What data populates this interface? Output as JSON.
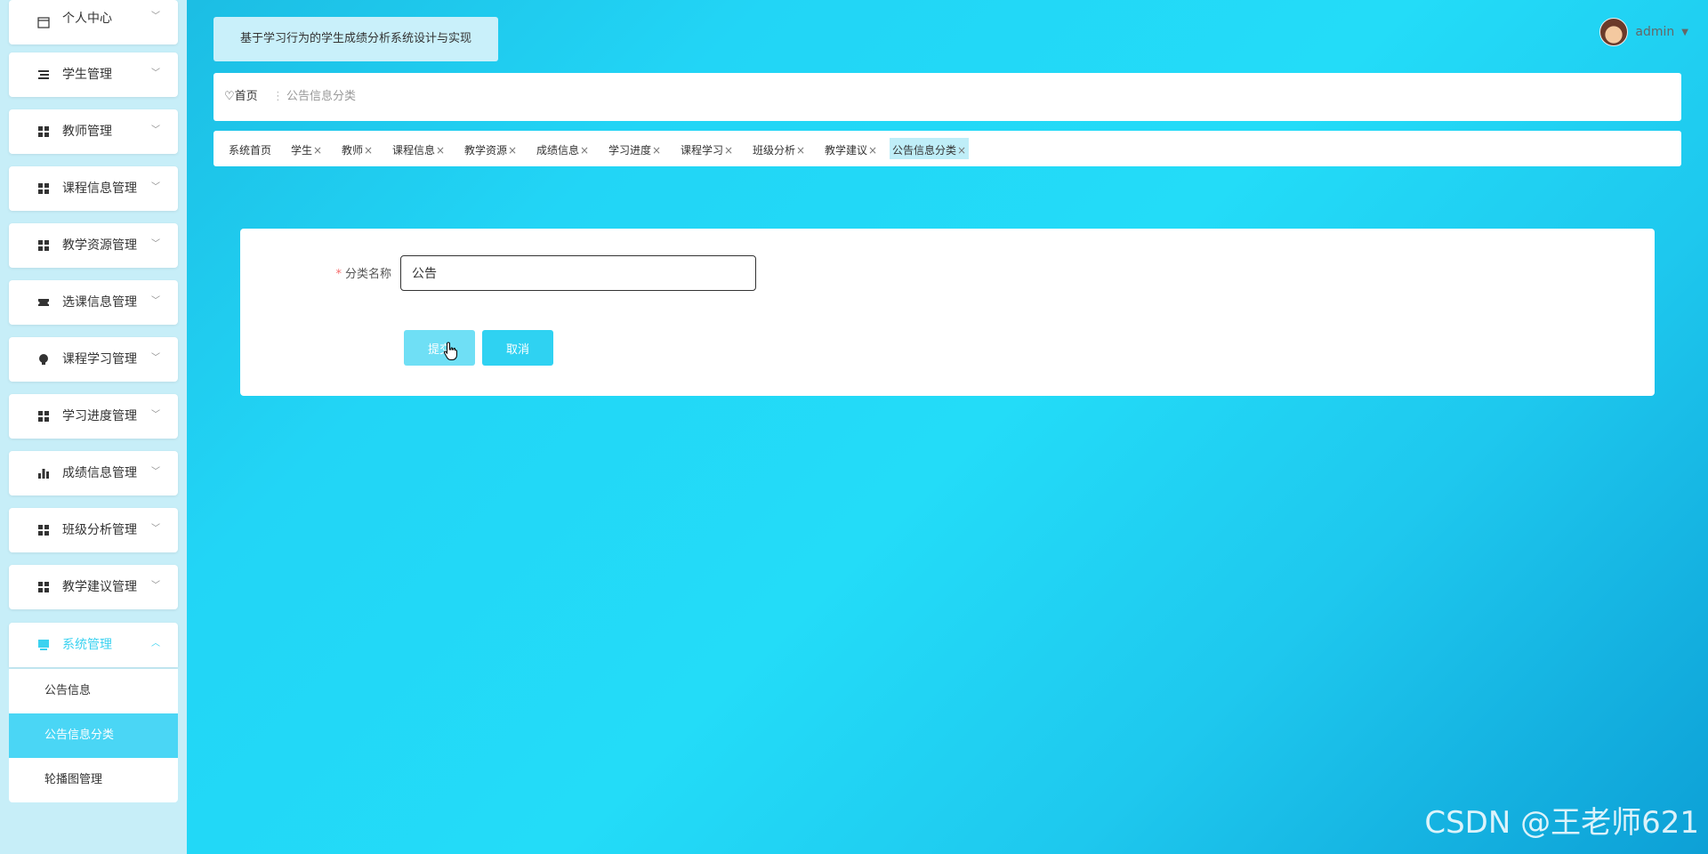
{
  "sidebar": {
    "items": [
      {
        "label": "个人中心",
        "icon": "calendar-icon"
      },
      {
        "label": "学生管理",
        "icon": "list-icon"
      },
      {
        "label": "教师管理",
        "icon": "grid-icon"
      },
      {
        "label": "课程信息管理",
        "icon": "grid-icon"
      },
      {
        "label": "教学资源管理",
        "icon": "grid-icon"
      },
      {
        "label": "选课信息管理",
        "icon": "ticket-icon"
      },
      {
        "label": "课程学习管理",
        "icon": "bulb-icon"
      },
      {
        "label": "学习进度管理",
        "icon": "grid-icon"
      },
      {
        "label": "成绩信息管理",
        "icon": "bar-chart-icon"
      },
      {
        "label": "班级分析管理",
        "icon": "grid-icon"
      },
      {
        "label": "教学建议管理",
        "icon": "grid-icon"
      },
      {
        "label": "系统管理",
        "icon": "monitor-icon",
        "expanded": true
      }
    ],
    "submenu": [
      {
        "label": "公告信息"
      },
      {
        "label": "公告信息分类",
        "selected": true
      },
      {
        "label": "轮播图管理"
      }
    ]
  },
  "header": {
    "title": "基于学习行为的学生成绩分析系统设计与实现",
    "user": "admin"
  },
  "breadcrumb": {
    "home": "首页",
    "separator": "⋮",
    "current": "公告信息分类"
  },
  "tabs": [
    {
      "label": "系统首页",
      "closable": false
    },
    {
      "label": "学生",
      "closable": true
    },
    {
      "label": "教师",
      "closable": true
    },
    {
      "label": "课程信息",
      "closable": true
    },
    {
      "label": "教学资源",
      "closable": true
    },
    {
      "label": "成绩信息",
      "closable": true
    },
    {
      "label": "学习进度",
      "closable": true
    },
    {
      "label": "课程学习",
      "closable": true
    },
    {
      "label": "班级分析",
      "closable": true
    },
    {
      "label": "教学建议",
      "closable": true
    },
    {
      "label": "公告信息分类",
      "closable": true,
      "active": true
    }
  ],
  "form": {
    "field_label": "分类名称",
    "required_mark": "*",
    "field_value": "公告",
    "submit_label": "提交",
    "cancel_label": "取消"
  },
  "watermark": "CSDN @王老师621",
  "colors": {
    "accent": "#3cd2f0",
    "selected_bg": "#4ad6f5",
    "required": "#f56c6c"
  }
}
